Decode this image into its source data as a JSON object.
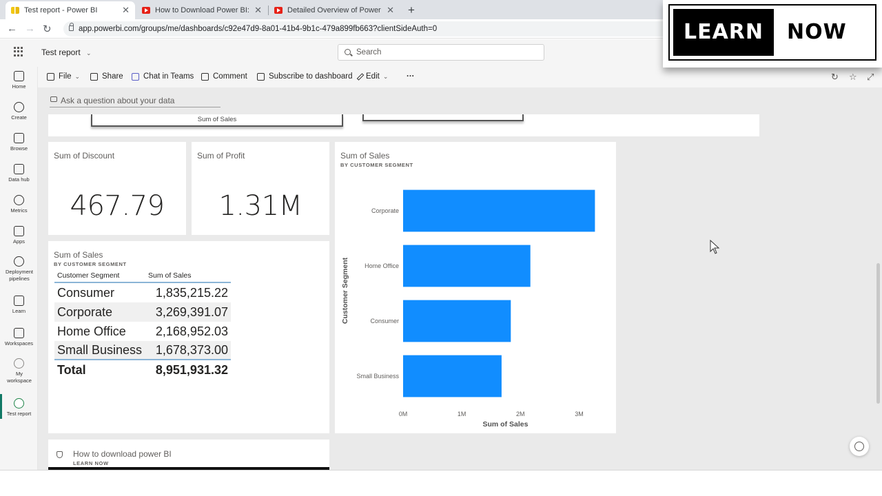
{
  "browser": {
    "tabs": [
      {
        "title": "Test report - Power BI",
        "favicon": "powerbi-icon"
      },
      {
        "title": "How to Download Power BI: Step",
        "favicon": "youtube-icon"
      },
      {
        "title": "Detailed Overview of Power BI In",
        "favicon": "youtube-icon"
      }
    ],
    "new_tab": "+",
    "url": "app.powerbi.com/groups/me/dashboards/c92e47d9-8a01-41b4-9b1c-479a899fb663?clientSideAuth=0"
  },
  "header": {
    "report_name": "Test report",
    "search_placeholder": "Search"
  },
  "leftnav": [
    {
      "label": "Home",
      "icon": "home-icon"
    },
    {
      "label": "Create",
      "icon": "plus-circle-icon"
    },
    {
      "label": "Browse",
      "icon": "folder-icon"
    },
    {
      "label": "Data hub",
      "icon": "database-icon"
    },
    {
      "label": "Metrics",
      "icon": "trophy-icon"
    },
    {
      "label": "Apps",
      "icon": "apps-icon"
    },
    {
      "label": "Deployment pipelines",
      "icon": "rocket-icon"
    },
    {
      "label": "Learn",
      "icon": "book-icon"
    },
    {
      "label": "Workspaces",
      "icon": "workspaces-icon"
    },
    {
      "label": "My workspace",
      "icon": "user-icon"
    },
    {
      "label": "Test report",
      "icon": "dashboard-gauge-icon"
    }
  ],
  "commands": {
    "file": "File",
    "share": "Share",
    "chat": "Chat in Teams",
    "comment": "Comment",
    "subscribe": "Subscribe to dashboard",
    "edit": "Edit",
    "more": "···"
  },
  "qna_placeholder": "Ask a question about your data",
  "top_tile_caption": "Sum of Sales",
  "kpis": {
    "discount": {
      "title": "Sum of Discount",
      "value": "467.79"
    },
    "profit": {
      "title": "Sum of Profit",
      "value": "1.31M"
    }
  },
  "table_tile": {
    "title": "Sum of Sales",
    "subtitle": "BY CUSTOMER SEGMENT",
    "headers": [
      "Customer Segment",
      "Sum of Sales"
    ],
    "rows": [
      [
        "Consumer",
        "1,835,215.22"
      ],
      [
        "Corporate",
        "3,269,391.07"
      ],
      [
        "Home Office",
        "2,168,952.03"
      ],
      [
        "Small Business",
        "1,678,373.00"
      ]
    ],
    "total": [
      "Total",
      "8,951,931.32"
    ]
  },
  "chart_tile": {
    "title": "Sum of Sales",
    "subtitle": "BY CUSTOMER SEGMENT"
  },
  "chart_data": {
    "type": "bar",
    "orientation": "horizontal",
    "categories": [
      "Corporate",
      "Home Office",
      "Consumer",
      "Small Business"
    ],
    "values": [
      3269391.07,
      2168952.03,
      1835215.22,
      1678373.0
    ],
    "xlabel": "Sum of Sales",
    "ylabel": "Customer Segment",
    "xticks": [
      "0M",
      "1M",
      "2M",
      "3M"
    ],
    "xlim": [
      0,
      3300000
    ],
    "bar_color": "#118dff",
    "grid": false
  },
  "bottom_tile": {
    "title": "How to download power BI",
    "subtitle": "LEARN NOW"
  },
  "logo": {
    "left": "LEARN",
    "right": "NOW"
  }
}
